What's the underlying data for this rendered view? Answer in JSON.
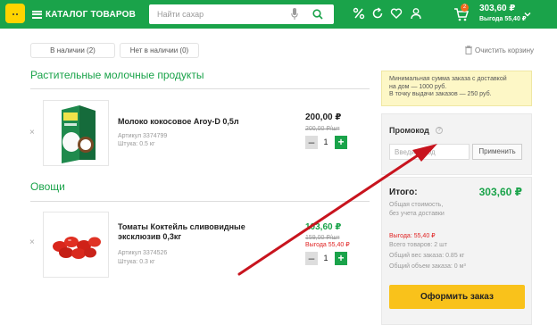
{
  "header": {
    "catalog_label": "КАТАЛОГ ТОВАРОВ",
    "search_placeholder": "Найти сахар",
    "cart_count": "2",
    "cart_total": "303,60 ₽",
    "cart_benefit": "Выгода 55,40 ₽",
    "icons": [
      "logo",
      "menu-icon",
      "microphone-icon",
      "search-icon",
      "percent-icon",
      "reorder-icon",
      "heart-icon",
      "user-icon",
      "cart-icon",
      "chevron-down-icon"
    ]
  },
  "filters": {
    "in_stock": "В наличии (2)",
    "out_of_stock": "Нет в наличии (0)",
    "clear_cart": "Очистить корзину"
  },
  "sections": [
    {
      "title": "Растительные молочные продукты",
      "items": [
        {
          "name": "Молоко кокосовое Aroy-D 0,5л",
          "article": "Артикул 3374799",
          "unit": "Штука: 0.5 кг",
          "price": "200,00 ₽",
          "unit_price": "200,00 ₽/шт",
          "qty": "1"
        }
      ]
    },
    {
      "title": "Овощи",
      "items": [
        {
          "name": "Томаты Коктейль сливовидные эксклюзив 0,3кг",
          "article": "Артикул 3374526",
          "unit": "Штука: 0.3 кг",
          "price": "103,60 ₽",
          "old_price": "159,00 ₽/шт",
          "benefit": "Выгода 55,40 ₽",
          "qty": "1"
        }
      ]
    }
  ],
  "qty_controls": {
    "minus": "–",
    "plus": "+"
  },
  "remove_symbol": "×",
  "sidebar": {
    "min_sum_lines": [
      "Минимальная сумма заказа с доставкой",
      "на дом — 1000 руб.",
      "В точку выдачи заказов — 250 руб."
    ],
    "promo_label": "Промокод",
    "promo_help": "?",
    "promo_placeholder": "Введите код",
    "promo_apply": "Применить",
    "total_label": "Итого:",
    "total_value": "303,60 ₽",
    "total_note_lines": [
      "Общая стоимость,",
      "без учета доставки"
    ],
    "benefit": "Выгода: 55,40 ₽",
    "total_items": "Всего товаров: 2 шт",
    "total_weight": "Общий вес заказа: 0.85 кг",
    "total_volume": "Общий объем заказа: 0 м³",
    "order_button": "Оформить заказ"
  },
  "colors": {
    "brand_green": "#1aa34a",
    "accent_yellow": "#f9c21b",
    "benefit_red": "#e02424",
    "annotation_arrow": "#c8141e"
  }
}
